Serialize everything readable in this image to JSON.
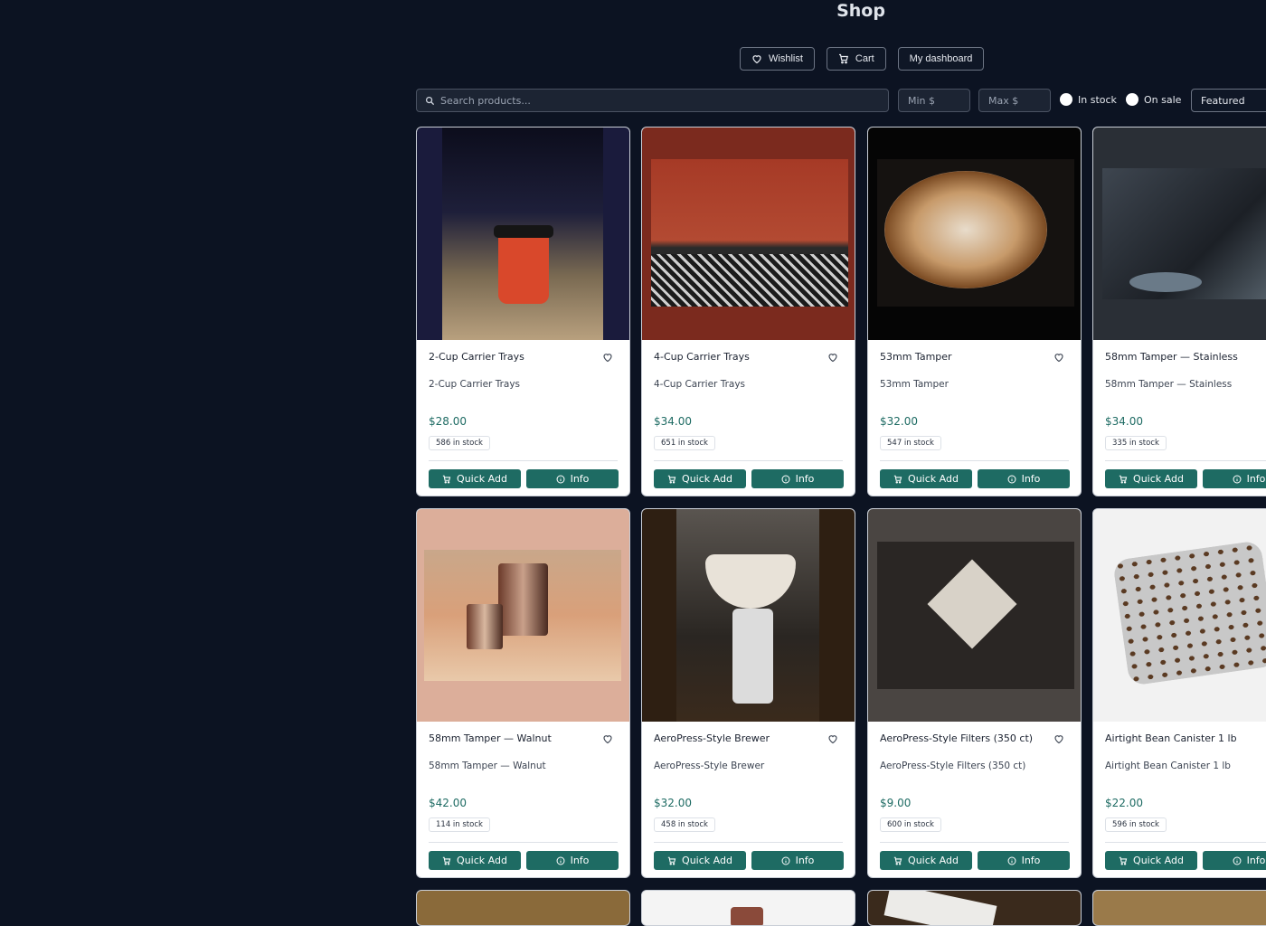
{
  "page_title": "Shop",
  "top_buttons": {
    "wishlist": "Wishlist",
    "cart": "Cart",
    "dashboard": "My dashboard"
  },
  "filters": {
    "search_placeholder": "Search products...",
    "min_placeholder": "Min $",
    "max_placeholder": "Max $",
    "in_stock": "In stock",
    "on_sale": "On sale",
    "sort": "Featured"
  },
  "card_buttons": {
    "quick_add": "Quick Add",
    "info": "Info"
  },
  "products": [
    {
      "name": "2-Cup Carrier Trays",
      "desc": "2-Cup Carrier Trays",
      "price": "$28.00",
      "stock": "586 in stock",
      "bg": "#1a1b3c"
    },
    {
      "name": "4-Cup Carrier Trays",
      "desc": "4-Cup Carrier Trays",
      "price": "$34.00",
      "stock": "651 in stock",
      "bg": "#7b2a1e"
    },
    {
      "name": "53mm Tamper",
      "desc": "53mm Tamper",
      "price": "$32.00",
      "stock": "547 in stock",
      "bg": "#050505"
    },
    {
      "name": "58mm Tamper — Stainless",
      "desc": "58mm Tamper — Stainless",
      "price": "$34.00",
      "stock": "335 in stock",
      "bg": "#2a2f36"
    },
    {
      "name": "58mm Tamper — Walnut",
      "desc": "58mm Tamper — Walnut",
      "price": "$42.00",
      "stock": "114 in stock",
      "bg": "#dcae9a"
    },
    {
      "name": "AeroPress-Style Brewer",
      "desc": "AeroPress-Style Brewer",
      "price": "$32.00",
      "stock": "458 in stock",
      "bg": "#2e1f12"
    },
    {
      "name": "AeroPress-Style Filters (350 ct)",
      "desc": "AeroPress-Style Filters (350 ct)",
      "price": "$9.00",
      "stock": "600 in stock",
      "bg": "#4a4542"
    },
    {
      "name": "Airtight Bean Canister 1 lb",
      "desc": "Airtight Bean Canister 1 lb",
      "price": "$22.00",
      "stock": "596 in stock",
      "bg": "#f2f2f2"
    }
  ]
}
